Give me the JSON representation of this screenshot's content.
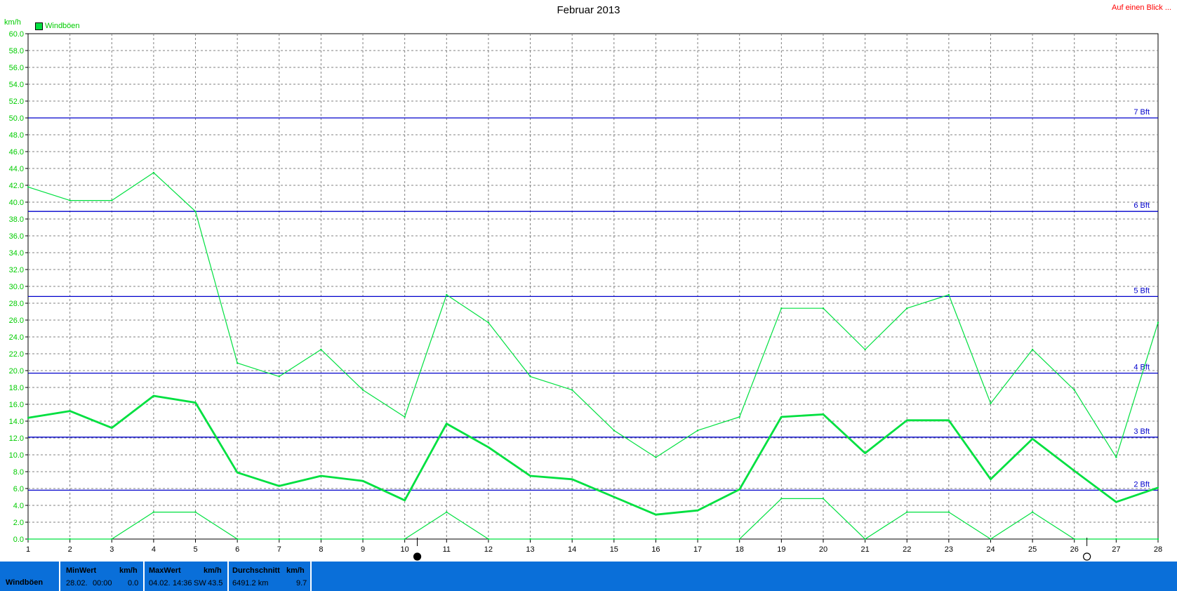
{
  "header": {
    "title": "Februar 2013",
    "top_link": "Auf einen Blick ...",
    "y_unit": "km/h",
    "legend_label": "Windböen"
  },
  "colors": {
    "series": "#00e040",
    "grid": "#808080",
    "bft_line": "#0000cc",
    "link": "#ff0000",
    "footer_bg": "#0a6fd9"
  },
  "chart_data": {
    "type": "line",
    "title": "Februar 2013",
    "ylabel": "km/h",
    "ylim": [
      0,
      60
    ],
    "y_ticks": [
      "0.0",
      "2.0",
      "4.0",
      "6.0",
      "8.0",
      "10.0",
      "12.0",
      "14.0",
      "16.0",
      "18.0",
      "20.0",
      "22.0",
      "24.0",
      "26.0",
      "28.0",
      "30.0",
      "32.0",
      "34.0",
      "36.0",
      "38.0",
      "40.0",
      "42.0",
      "44.0",
      "46.0",
      "48.0",
      "50.0",
      "52.0",
      "54.0",
      "56.0",
      "58.0",
      "60.0"
    ],
    "x": [
      1,
      2,
      3,
      4,
      5,
      6,
      7,
      8,
      9,
      10,
      11,
      12,
      13,
      14,
      15,
      16,
      17,
      18,
      19,
      20,
      21,
      22,
      23,
      24,
      25,
      26,
      27,
      28
    ],
    "x_tick_labels": [
      "1",
      "2",
      "3",
      "4",
      "5",
      "6",
      "7",
      "8",
      "9",
      "10",
      "11",
      "12",
      "13",
      "14",
      "15",
      "16",
      "17",
      "18",
      "19",
      "20",
      "21",
      "22",
      "23",
      "24",
      "25",
      "26",
      "27",
      "28"
    ],
    "grid": true,
    "series": [
      {
        "name": "Windböen",
        "role": "max",
        "values": [
          41.8,
          40.2,
          40.2,
          43.5,
          38.9,
          20.9,
          19.3,
          22.5,
          17.7,
          14.5,
          29.0,
          25.7,
          19.3,
          17.7,
          12.9,
          9.7,
          12.9,
          14.5,
          27.4,
          27.4,
          22.5,
          27.4,
          29.0,
          16.1,
          22.5,
          17.7,
          9.7,
          25.7
        ]
      },
      {
        "name": "Windböen",
        "role": "mean",
        "values": [
          14.4,
          15.2,
          13.2,
          17.0,
          16.2,
          7.9,
          6.3,
          7.5,
          6.9,
          4.6,
          13.7,
          10.9,
          7.5,
          7.1,
          5.0,
          2.9,
          3.4,
          5.9,
          14.5,
          14.8,
          10.2,
          14.1,
          14.1,
          7.1,
          11.9,
          8.1,
          4.4,
          6.1
        ]
      },
      {
        "name": "Windböen",
        "role": "min",
        "values": [
          0.0,
          0.0,
          0.0,
          3.2,
          3.2,
          0.0,
          0.0,
          0.0,
          0.0,
          0.0,
          3.2,
          0.0,
          0.0,
          0.0,
          0.0,
          0.0,
          0.0,
          0.0,
          4.8,
          4.8,
          0.0,
          3.2,
          3.2,
          0.0,
          3.2,
          0.0,
          0.0,
          0.0
        ]
      }
    ],
    "reference_lines": [
      {
        "label": "2 Bft",
        "value": 5.8
      },
      {
        "label": "3 Bft",
        "value": 12.1
      },
      {
        "label": "4 Bft",
        "value": 19.7
      },
      {
        "label": "5 Bft",
        "value": 28.8
      },
      {
        "label": "6 Bft",
        "value": 38.9
      },
      {
        "label": "7 Bft",
        "value": 50.0
      }
    ],
    "moon_phases": [
      {
        "day": 10,
        "phase": "new-moon"
      },
      {
        "day": 26,
        "phase": "full-moon"
      }
    ]
  },
  "footer": {
    "row_label": "Windböen",
    "min": {
      "label": "MinWert",
      "unit": "km/h",
      "date": "28.02.",
      "time": "00:00",
      "value": "0.0"
    },
    "max": {
      "label": "MaxWert",
      "unit": "km/h",
      "date": "04.02.",
      "time": "14:36",
      "dir": "SW",
      "value": "43.5"
    },
    "avg": {
      "label": "Durchschnitt",
      "unit": "km/h",
      "distance": "6491.2 km",
      "value": "9.7"
    }
  }
}
